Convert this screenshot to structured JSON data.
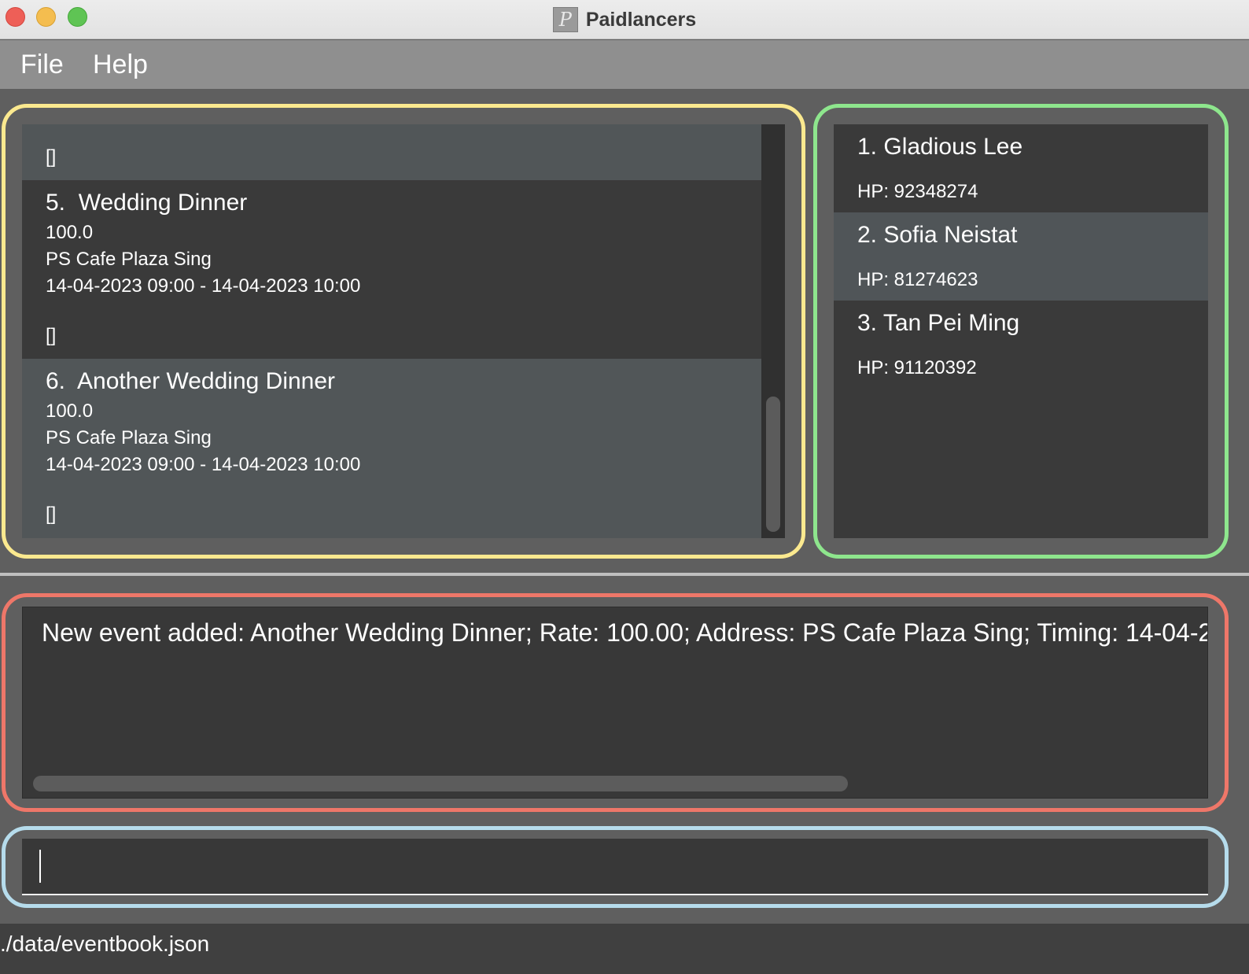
{
  "window": {
    "title": "Paidlancers"
  },
  "menu": {
    "file": "File",
    "help": "Help"
  },
  "events": [
    {
      "tags": "[]"
    },
    {
      "index": "5.",
      "name": "Wedding Dinner",
      "rate": "100.0",
      "address": "PS Cafe Plaza Sing",
      "timing": "14-04-2023 09:00 - 14-04-2023 10:00",
      "tags": "[]"
    },
    {
      "index": "6.",
      "name": "Another Wedding Dinner",
      "rate": "100.0",
      "address": "PS Cafe Plaza Sing",
      "timing": "14-04-2023 09:00 - 14-04-2023 10:00",
      "tags": "[]"
    }
  ],
  "persons": [
    {
      "name": "1. Gladious Lee",
      "phone": "HP: 92348274"
    },
    {
      "name": "2. Sofia Neistat",
      "phone": "HP: 81274623"
    },
    {
      "name": "3. Tan Pei Ming",
      "phone": "HP: 91120392"
    }
  ],
  "result": {
    "text": "New event added: Another Wedding Dinner; Rate: 100.00; Address: PS Cafe Plaza Sing; Timing: 14-04-2"
  },
  "command": {
    "value": ""
  },
  "status": {
    "path": "./data/eventbook.json"
  },
  "outline_colors": {
    "event_list": "#fbe98f",
    "person_list": "#8ee68d",
    "result": "#ee7769",
    "command": "#b6dcec"
  }
}
